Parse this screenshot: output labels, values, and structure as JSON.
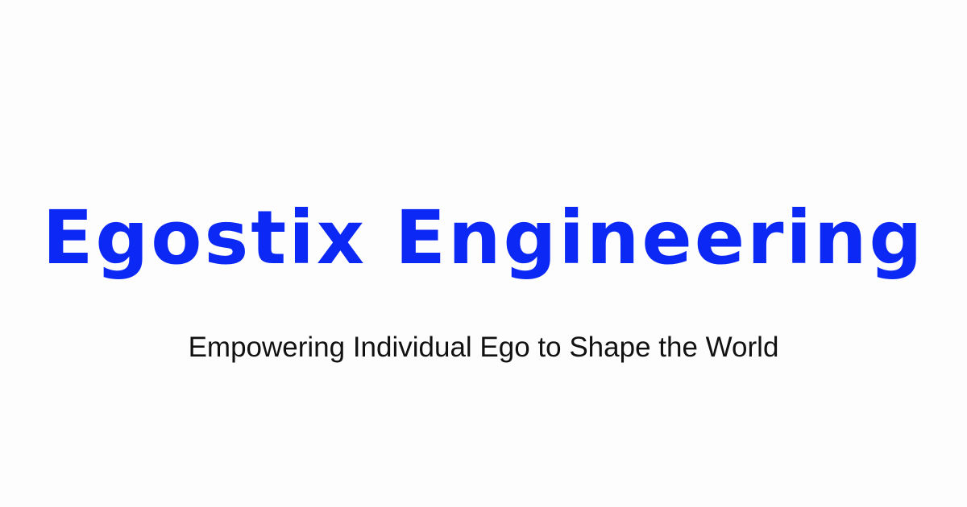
{
  "brand": {
    "title": "Egostix Engineering",
    "tagline": "Empowering Individual Ego to Shape the World"
  },
  "colors": {
    "accent": "#0b28f5",
    "text": "#111111",
    "background": "#fdfdfd"
  }
}
